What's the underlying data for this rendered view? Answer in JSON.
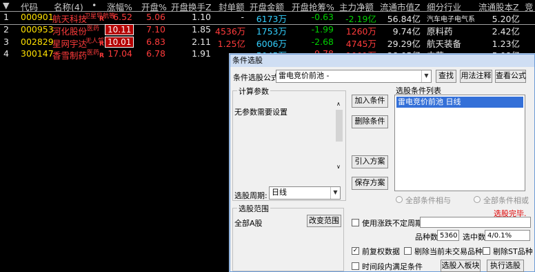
{
  "table": {
    "headers": [
      "代码",
      "名称(4)",
      "•",
      "涨幅%",
      "开盘%",
      "开盘换手Z",
      "封单额",
      "开盘金额",
      "开盘抢筹%",
      "主力净额",
      "流通市值Z",
      "细分行业",
      "流通股本Z",
      "竞"
    ],
    "rows": [
      {
        "idx": "1",
        "code": "000901",
        "name": "航天科技",
        "tag": "卫星导航等",
        "badge": "R",
        "chg": "6.52",
        "open": "5.06",
        "turn": "1.10",
        "seal": "-",
        "amount": "6173万",
        "grab": "-0.63",
        "net": "-2.19亿",
        "cap": "56.84亿",
        "ind": "汽车电子电气系",
        "shares": "5.20亿"
      },
      {
        "idx": "2",
        "code": "000953",
        "name": "河化股份",
        "tag": "医药",
        "badge": "",
        "chg": "10.11",
        "open": "7.10",
        "turn": "1.85",
        "seal": "4536万",
        "amount": "1753万",
        "grab": "-1.99",
        "net": "1260万",
        "cap": "9.74亿",
        "ind": "原料药",
        "shares": "2.42亿"
      },
      {
        "idx": "3",
        "code": "002829",
        "name": "星网宇达",
        "tag": "无人驾驶",
        "badge": "R",
        "chg": "10.01",
        "open": "6.83",
        "turn": "2.11",
        "seal": "1.25亿",
        "amount": "6006万",
        "grab": "-2.68",
        "net": "4745万",
        "cap": "29.29亿",
        "ind": "航天装备",
        "shares": "1.23亿"
      },
      {
        "idx": "4",
        "code": "300147",
        "name": "香雪制药",
        "tag": "医药",
        "badge": "R",
        "chg": "17.04",
        "open": "6.78",
        "turn": "1.91",
        "seal": "",
        "amount": "5045万",
        "grab": "-9.78",
        "net": "1001万",
        "cap": "28.05亿",
        "ind": "中药",
        "shares": "5.08亿"
      }
    ]
  },
  "dialog": {
    "title": "条件选股",
    "formula_label": "条件选股公式",
    "formula_value": "雷电竞价前池  -",
    "find_btn": "查找",
    "usage_btn": "用法注释",
    "formula_btn": "查看公式",
    "calc_group": "计算参数",
    "no_params": "无参数需要设置",
    "add_btn": "加入条件",
    "del_btn": "删除条件",
    "import_btn": "引入方案",
    "save_btn": "保存方案",
    "cond_list_label": "选股条件列表",
    "cond_item": "雷电竞价前池  日线",
    "period_label": "选股周期:",
    "period_value": "日线",
    "and_label": "全部条件相与",
    "or_label": "全部条件相或",
    "done_text": "选股完毕.",
    "range_group": "选股范围",
    "range_value": "全部A股",
    "change_range_btn": "改变范围",
    "uncertain_label": "使用涨跌不定周期",
    "count_label": "品种数",
    "count_value": "5360",
    "selected_label": "选中数",
    "selected_value": "4/0.1%",
    "fq_label": "前复权数据",
    "del_untraded_label": "剔除当前未交易品种",
    "del_st_label": "剔除ST品种",
    "period_satisfy_label": "时间段内满足条件",
    "to_board_btn": "选股入板块",
    "exec_btn": "执行选股"
  }
}
